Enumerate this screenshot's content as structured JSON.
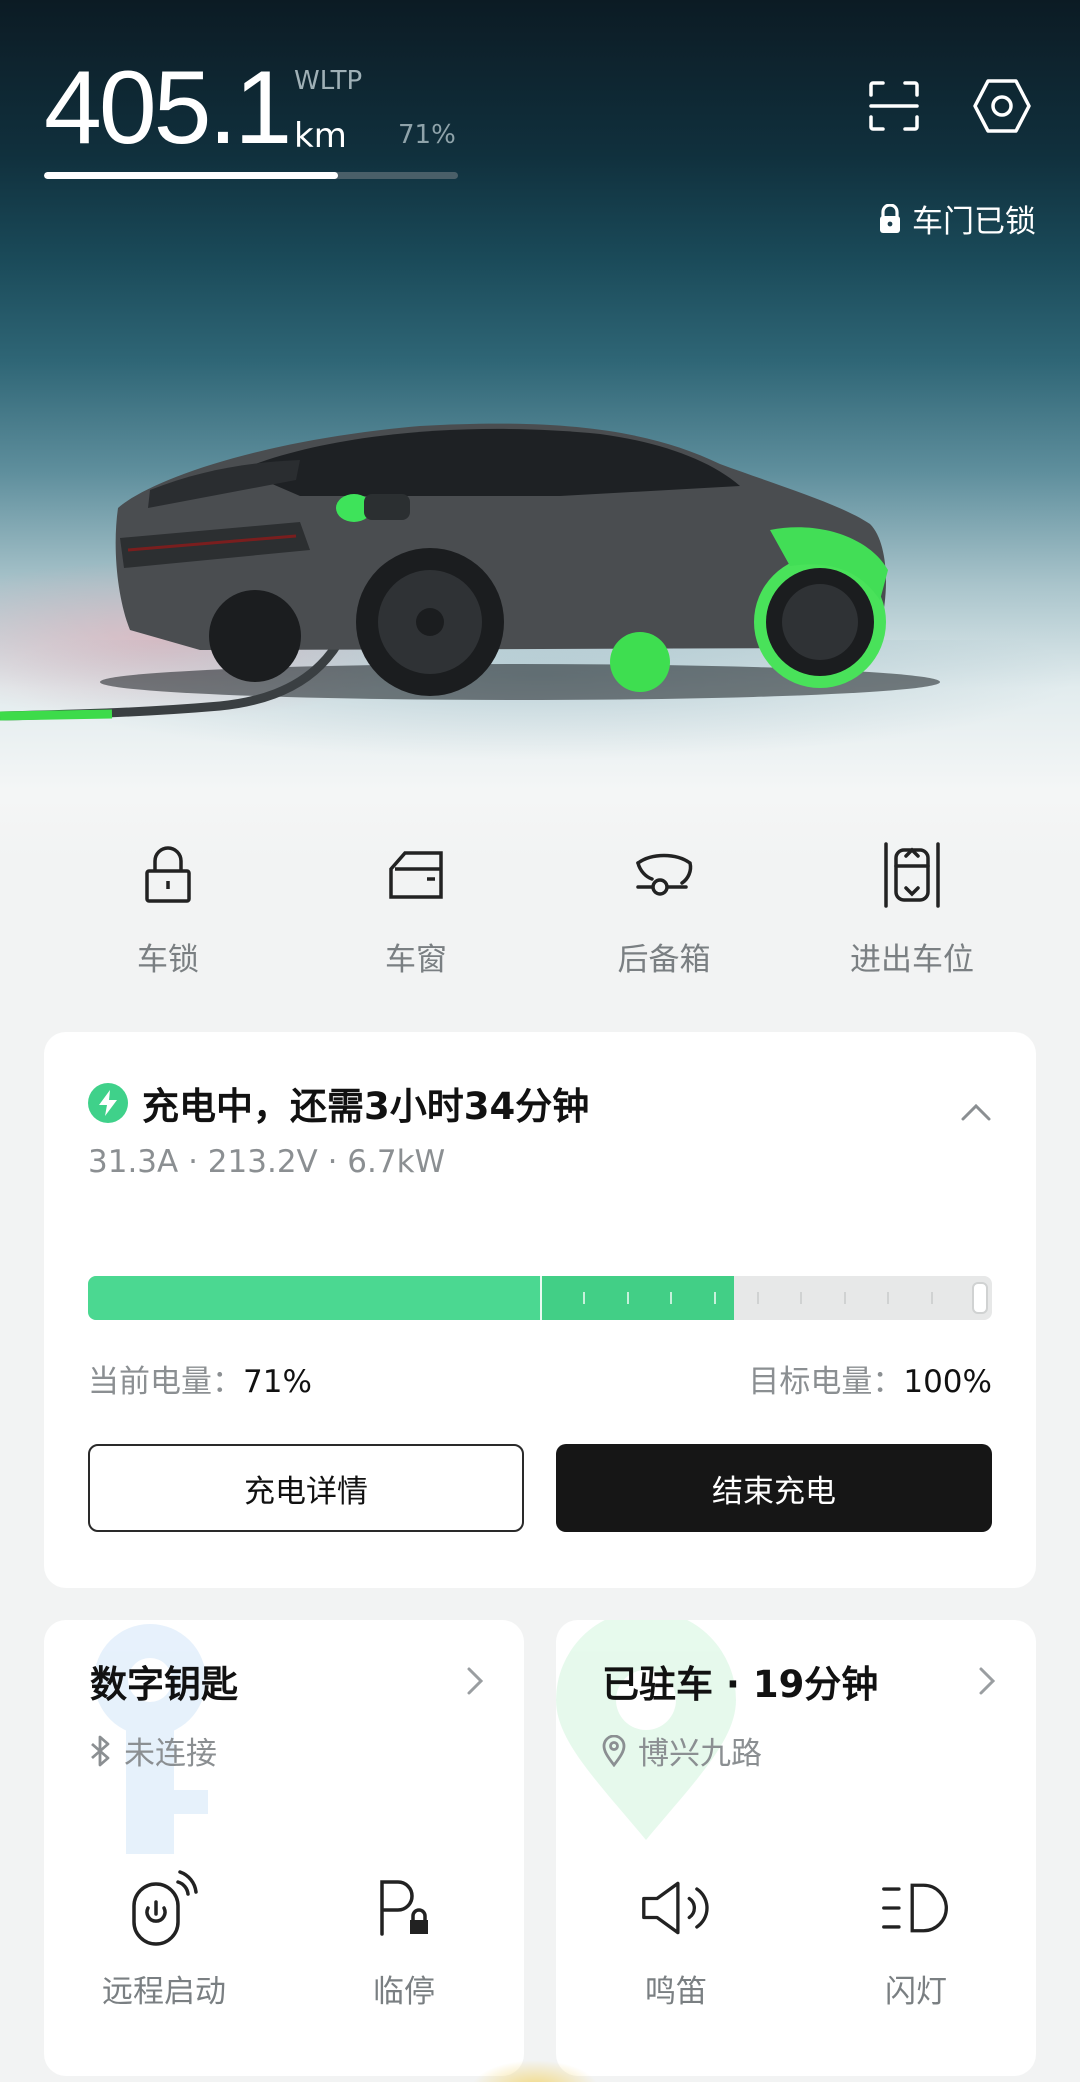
{
  "range": {
    "value": "405.1",
    "unit": "km",
    "standard": "WLTP",
    "battery_percent": "71%",
    "level": 0.71
  },
  "status": {
    "lock_text": "车门已锁"
  },
  "quick_actions": [
    {
      "icon": "lock-icon",
      "label": "车锁"
    },
    {
      "icon": "window-icon",
      "label": "车窗"
    },
    {
      "icon": "trunk-icon",
      "label": "后备箱"
    },
    {
      "icon": "parking-icon",
      "label": "进出车位"
    }
  ],
  "charging": {
    "title": "充电中，还需3小时34分钟",
    "metrics": "31.3A  · 213.2V  · 6.7kW",
    "current_label": "当前电量：",
    "current_value": "71%",
    "target_label": "目标电量：",
    "target_value": "100%",
    "current_level": 0.5,
    "session_level": 0.715,
    "details_button": "充电详情",
    "stop_button": "结束充电"
  },
  "digital_key": {
    "title": "数字钥匙",
    "status": "未连接",
    "actions": [
      {
        "icon": "remote-start-icon",
        "label": "远程启动"
      },
      {
        "icon": "temp-parking-icon",
        "label": "临停"
      }
    ]
  },
  "parking": {
    "title": "已驻车 · 19分钟",
    "location": "博兴九路",
    "actions": [
      {
        "icon": "horn-icon",
        "label": "鸣笛"
      },
      {
        "icon": "flash-lights-icon",
        "label": "闪灯"
      }
    ]
  },
  "colors": {
    "accent_green": "#4bd891",
    "dark_button": "#161616",
    "background": "#f2f3f3"
  }
}
